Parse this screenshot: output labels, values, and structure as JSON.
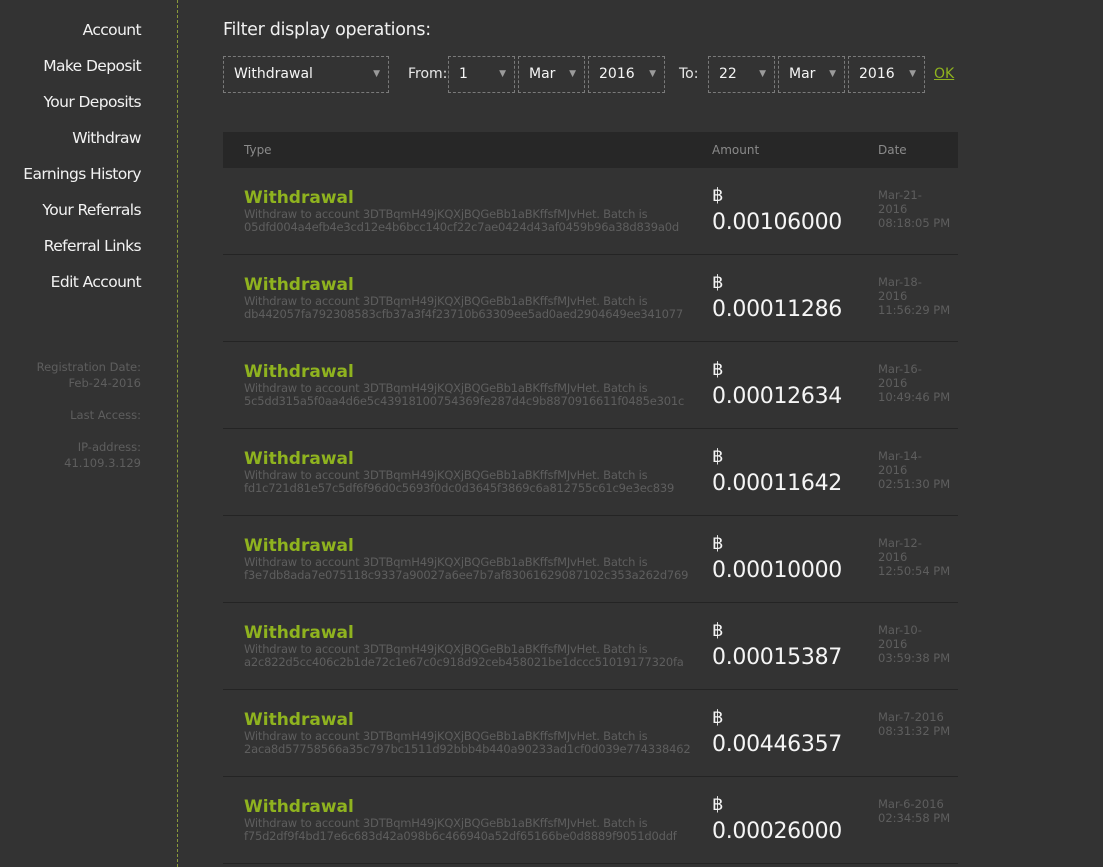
{
  "sidebar": {
    "nav": [
      {
        "label": "Account"
      },
      {
        "label": "Make Deposit"
      },
      {
        "label": "Your Deposits"
      },
      {
        "label": "Withdraw"
      },
      {
        "label": "Earnings History"
      },
      {
        "label": "Your Referrals"
      },
      {
        "label": "Referral Links"
      },
      {
        "label": "Edit Account"
      }
    ],
    "info": {
      "registration_label": "Registration Date:",
      "registration_value": "Feb-24-2016",
      "last_access_label": "Last Access:",
      "ip_label": "IP-address:",
      "ip_value": "41.109.3.129"
    }
  },
  "filter": {
    "title": "Filter display operations:",
    "type_value": "Withdrawal",
    "from_label": "From:",
    "from_day": "1",
    "from_month": "Mar",
    "from_year": "2016",
    "to_label": "To:",
    "to_day": "22",
    "to_month": "Mar",
    "to_year": "2016",
    "ok_label": "OK"
  },
  "table": {
    "headers": {
      "type": "Type",
      "amount": "Amount",
      "date": "Date"
    },
    "currency_symbol": "฿",
    "rows": [
      {
        "type": "Withdrawal",
        "desc1": "Withdraw to account 3DTBqmH49jKQXjBQGeBb1aBKffsfMJvHet. Batch is",
        "desc2": "05dfd004a4efb4e3cd12e4b6bcc140cf22c7ae0424d43af0459b96a38d839a0d",
        "amount": "0.00106000",
        "date1": "Mar-21-",
        "date2": "2016",
        "time": "08:18:05 PM"
      },
      {
        "type": "Withdrawal",
        "desc1": "Withdraw to account 3DTBqmH49jKQXjBQGeBb1aBKffsfMJvHet. Batch is",
        "desc2": "db442057fa792308583cfb37a3f4f23710b63309ee5ad0aed2904649ee341077",
        "amount": "0.00011286",
        "date1": "Mar-18-",
        "date2": "2016",
        "time": "11:56:29 PM"
      },
      {
        "type": "Withdrawal",
        "desc1": "Withdraw to account 3DTBqmH49jKQXjBQGeBb1aBKffsfMJvHet. Batch is",
        "desc2": "5c5dd315a5f0aa4d6e5c43918100754369fe287d4c9b8870916611f0485e301c",
        "amount": "0.00012634",
        "date1": "Mar-16-",
        "date2": "2016",
        "time": "10:49:46 PM"
      },
      {
        "type": "Withdrawal",
        "desc1": "Withdraw to account 3DTBqmH49jKQXjBQGeBb1aBKffsfMJvHet. Batch is",
        "desc2": "fd1c721d81e57c5df6f96d0c5693f0dc0d3645f3869c6a812755c61c9e3ec839",
        "amount": "0.00011642",
        "date1": "Mar-14-",
        "date2": "2016",
        "time": "02:51:30 PM"
      },
      {
        "type": "Withdrawal",
        "desc1": "Withdraw to account 3DTBqmH49jKQXjBQGeBb1aBKffsfMJvHet. Batch is",
        "desc2": "f3e7db8ada7e075118c9337a90027a6ee7b7af83061629087102c353a262d769",
        "amount": "0.00010000",
        "date1": "Mar-12-",
        "date2": "2016",
        "time": "12:50:54 PM"
      },
      {
        "type": "Withdrawal",
        "desc1": "Withdraw to account 3DTBqmH49jKQXjBQGeBb1aBKffsfMJvHet. Batch is",
        "desc2": "a2c822d5cc406c2b1de72c1e67c0c918d92ceb458021be1dccc51019177320fa",
        "amount": "0.00015387",
        "date1": "Mar-10-",
        "date2": "2016",
        "time": "03:59:38 PM"
      },
      {
        "type": "Withdrawal",
        "desc1": "Withdraw to account 3DTBqmH49jKQXjBQGeBb1aBKffsfMJvHet. Batch is",
        "desc2": "2aca8d57758566a35c797bc1511d92bbb4b440a90233ad1cf0d039e774338462",
        "amount": "0.00446357",
        "date1": "Mar-7-2016",
        "date2": "",
        "time": "08:31:32 PM"
      },
      {
        "type": "Withdrawal",
        "desc1": "Withdraw to account 3DTBqmH49jKQXjBQGeBb1aBKffsfMJvHet. Batch is",
        "desc2": "f75d2df9f4bd17e6c683d42a098b6c466940a52df65166be0d8889f9051d0ddf",
        "amount": "0.00026000",
        "date1": "Mar-6-2016",
        "date2": "",
        "time": "02:34:58 PM"
      }
    ]
  }
}
